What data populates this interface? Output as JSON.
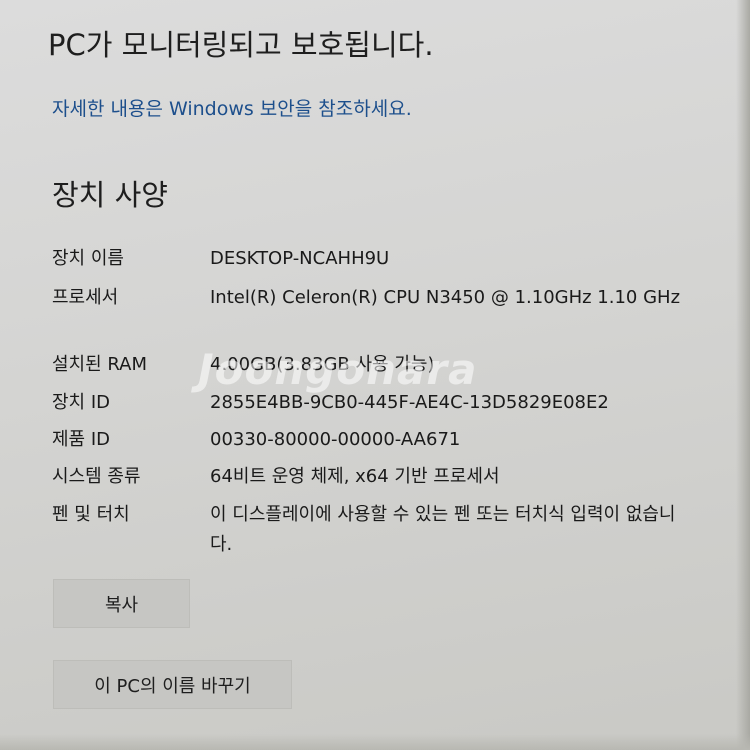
{
  "status": {
    "message": "PC가 모니터링되고 보호됩니다.",
    "security_link": "자세한 내용은 Windows 보안을 참조하세요."
  },
  "device_specs": {
    "title": "장치 사양",
    "rows": [
      {
        "label": "장치 이름",
        "value": "DESKTOP-NCAHH9U"
      },
      {
        "label": "프로세서",
        "value": "Intel(R) Celeron(R) CPU N3450 @ 1.10GHz   1.10 GHz"
      },
      {
        "label": "설치된 RAM",
        "value": "4.00GB(3.83GB 사용 가능)"
      },
      {
        "label": "장치 ID",
        "value": "2855E4BB-9CB0-445F-AE4C-13D5829E08E2"
      },
      {
        "label": "제품 ID",
        "value": "00330-80000-00000-AA671"
      },
      {
        "label": "시스템 종류",
        "value": "64비트 운영 체제, x64 기반 프로세서"
      },
      {
        "label": "펜 및 터치",
        "value": "이 디스플레이에 사용할 수 있는 펜 또는 터치식 입력이 없습니다."
      }
    ],
    "copy_button": "복사",
    "rename_button": "이 PC의 이름 바꾸기"
  },
  "watermark": "Joongonara"
}
